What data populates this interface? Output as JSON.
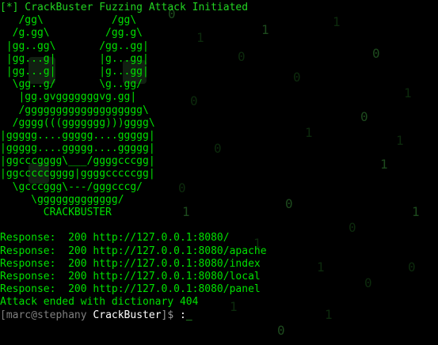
{
  "colors": {
    "background": "#000000",
    "text": "#00e000",
    "rain": "#0c2a0c",
    "prompt_muted": "#7f7f7f",
    "prompt_bright": "#ffffff"
  },
  "banner": "[*] CrackBuster Fuzzing Attack Initiated",
  "ascii_art": [
    "   /gg\\           /gg\\",
    "  /g.gg\\         /gg.g\\",
    " |gg..gg\\       /gg..gg|",
    " |gg...g|       |g...gg|",
    " |gg...g|       |g...gg|",
    "  \\gg..g/       \\g..gg/",
    "   |gg.gvgggggggvg.gg|",
    "   /ggggggggggggggggggg\\",
    "  /gggg(((ggggggg)))gggg\\",
    "|ggggg....ggggg....ggggg|",
    "|ggggg....ggggg....ggggg|",
    "|ggcccgggg\\___/ggggcccgg|",
    "|ggcccccgggg|ggggcccccgg|",
    "  \\gcccggg\\---/gggcccg/",
    "     \\ggggggggggggg/",
    "       CRACKBUSTER"
  ],
  "responses": [
    "Response:  200 http://127.0.0.1:8080/",
    "Response:  200 http://127.0.0.1:8080/apache",
    "Response:  200 http://127.0.0.1:8080/index",
    "Response:  200 http://127.0.0.1:8080/local",
    "Response:  200 http://127.0.0.1:8080/panel"
  ],
  "summary": "Attack ended with dictionary 404",
  "prompt": {
    "open_bracket": "[",
    "user": "marc",
    "at": "@",
    "host": "stephany",
    "dir": "CrackBuster",
    "close": "]$",
    "command": ":",
    "cursor": "_"
  },
  "matrix_rain": [
    "0",
    "1",
    "0",
    "1",
    "0",
    "1",
    "0",
    "1",
    "0",
    "1",
    "0",
    "1",
    "0",
    "1",
    "0",
    "1",
    "0",
    "1",
    "0",
    "1",
    "0",
    "1",
    "0",
    "1",
    "0",
    "1"
  ]
}
